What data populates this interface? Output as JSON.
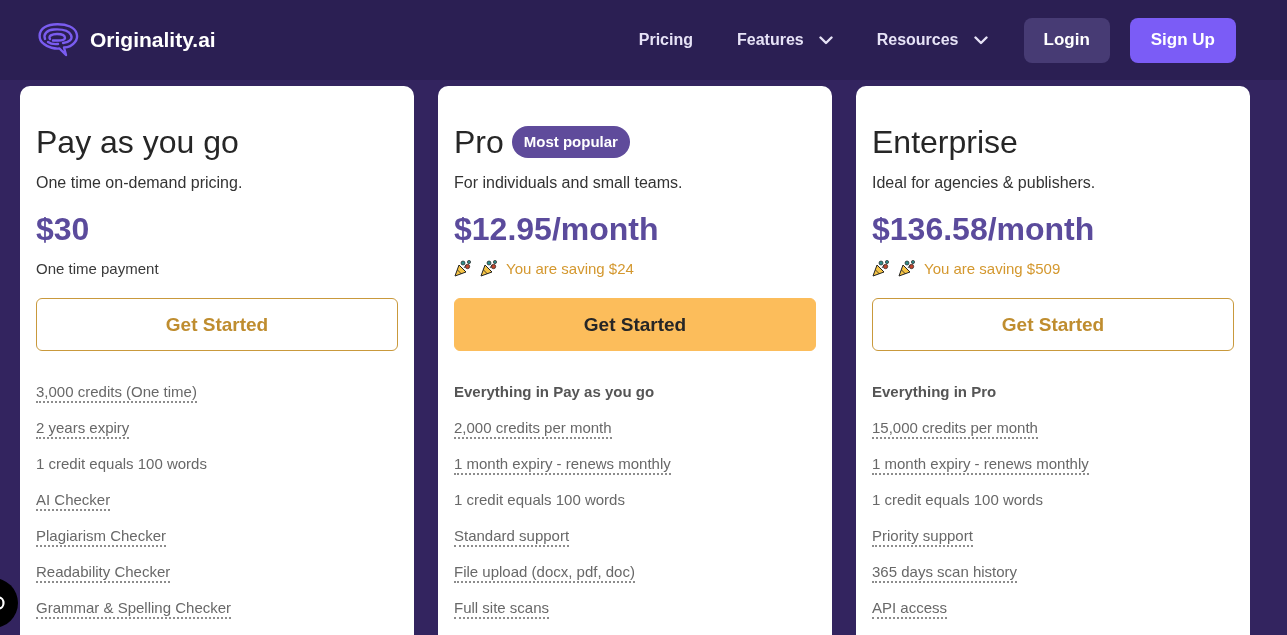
{
  "header": {
    "logo": {
      "text": "Originality.ai"
    },
    "nav": [
      {
        "label": "Pricing",
        "kind": "link"
      },
      {
        "label": "Features",
        "kind": "dropdown"
      },
      {
        "label": "Resources",
        "kind": "dropdown"
      }
    ],
    "buttons": [
      {
        "label": "Login",
        "kind": "login"
      },
      {
        "label": "Sign Up",
        "kind": "signup"
      }
    ]
  },
  "plans": [
    {
      "name": "Pay as you go",
      "description": "One time on-demand pricing.",
      "price": "$30",
      "note": {
        "kind": "plain",
        "text": "One time payment"
      },
      "button": {
        "label": "Get Started",
        "filled": false
      },
      "features": [
        {
          "text": "3,000 credits (One time)",
          "kind": "tooltip"
        },
        {
          "text": "2 years expiry",
          "kind": "tooltip"
        },
        {
          "text": "1 credit equals 100 words",
          "kind": "plain"
        },
        {
          "text": "AI Checker",
          "kind": "tooltip"
        },
        {
          "text": "Plagiarism Checker",
          "kind": "tooltip"
        },
        {
          "text": "Readability Checker",
          "kind": "tooltip"
        },
        {
          "text": "Grammar & Spelling Checker",
          "kind": "tooltip"
        }
      ]
    },
    {
      "name": "Pro",
      "badge": "Most popular",
      "description": "For individuals and small teams.",
      "price": "$12.95/month",
      "note": {
        "kind": "saving",
        "text": "You are saving $24"
      },
      "button": {
        "label": "Get Started",
        "filled": true
      },
      "features": [
        {
          "text": "Everything in Pay as you go",
          "kind": "heading"
        },
        {
          "text": "2,000 credits per month",
          "kind": "tooltip"
        },
        {
          "text": "1 month expiry - renews monthly",
          "kind": "tooltip"
        },
        {
          "text": "1 credit equals 100 words",
          "kind": "plain"
        },
        {
          "text": "Standard support",
          "kind": "tooltip"
        },
        {
          "text": "File upload (docx, pdf, doc)",
          "kind": "tooltip"
        },
        {
          "text": "Full site scans",
          "kind": "tooltip"
        }
      ]
    },
    {
      "name": "Enterprise",
      "description": "Ideal for agencies & publishers.",
      "price": "$136.58/month",
      "note": {
        "kind": "saving",
        "text": "You are saving $509"
      },
      "button": {
        "label": "Get Started",
        "filled": false
      },
      "features": [
        {
          "text": "Everything in Pro",
          "kind": "heading"
        },
        {
          "text": "15,000 credits per month",
          "kind": "tooltip"
        },
        {
          "text": "1 month expiry - renews monthly",
          "kind": "tooltip"
        },
        {
          "text": "1 credit equals 100 words",
          "kind": "plain"
        },
        {
          "text": "Priority support",
          "kind": "tooltip"
        },
        {
          "text": "365 days scan history",
          "kind": "tooltip"
        },
        {
          "text": "API access",
          "kind": "tooltip"
        }
      ]
    }
  ]
}
